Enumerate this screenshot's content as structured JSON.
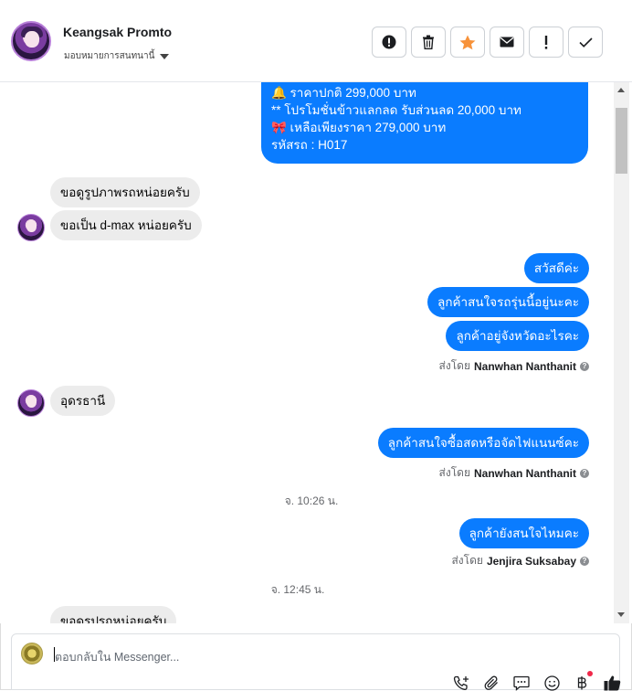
{
  "header": {
    "contact_name": "Keangsak Promto",
    "assign_label": "มอบหมายการสนทนานี้"
  },
  "composer": {
    "placeholder": "ตอบกลับใน Messenger..."
  },
  "messages": {
    "top_card_lines": [
      "🔔 ราคาปกติ 299,000 บาท",
      "** โปรโมชั่นข้าวแลกลด รับส่วนลด 20,000 บาท",
      "🎀  เหลือเพียงราคา 279,000 บาท",
      " รหัสรถ : H017"
    ],
    "in_1": "ขอดูรูปภาพรถหน่อยครับ",
    "in_2": "ขอเป็น d-max หน่อยครับ",
    "out_1": "สวัสดีค่ะ",
    "out_2": "ลูกค้าสนใจรถรุ่นนี้อยู่นะคะ",
    "out_3": "ลูกค้าอยู่จังหวัดอะไรคะ",
    "sent_by_label": "ส่งโดย",
    "sender_1": "Nanwhan Nanthanit",
    "in_3": "อุดรธานี",
    "out_4": "ลูกค้าสนใจซื้อสดหรือจัดไฟแนนซ์คะ",
    "sender_2": "Nanwhan Nanthanit",
    "time_1": "จ. 10:26 น.",
    "out_5": "ลูกค้ายังสนใจไหมคะ",
    "sender_3": "Jenjira Suksabay",
    "time_2": "จ. 12:45 น.",
    "in_4_partial": "ขอดูรูปรถหน่อยครับ"
  },
  "icons": {
    "actions": [
      "alert-circle-icon",
      "trash-icon",
      "star-icon",
      "envelope-icon",
      "exclamation-icon",
      "check-icon"
    ],
    "tools": [
      "phone-plus-icon",
      "paperclip-icon",
      "chat-bubble-icon",
      "smiley-icon",
      "baht-icon",
      "thumbs-up-icon"
    ]
  },
  "colors": {
    "outgoing_bubble": "#0a7cff",
    "incoming_bubble": "#ececec",
    "star": "#f7923a",
    "notification_dot": "#f02849"
  }
}
